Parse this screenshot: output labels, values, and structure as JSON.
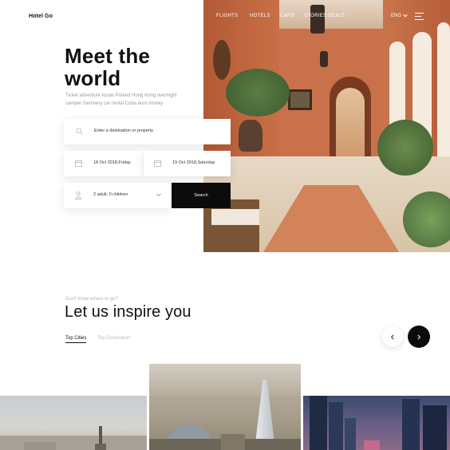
{
  "header": {
    "logo": "Hotel Go",
    "nav": [
      {
        "label": "FLIGHTS"
      },
      {
        "label": "HOTELS"
      },
      {
        "label": "CARS"
      },
      {
        "label": "STORIES"
      },
      {
        "label": "DEALS"
      }
    ],
    "language": "ENG",
    "icons": {
      "menu": "hamburger-menu-icon",
      "language_caret": "chevron-down-icon"
    }
  },
  "hero": {
    "title": "Meet the world",
    "subtitle": "Ticket adventure locals Poland Hong Kong overnight camper Germany car rental Cuba euro money"
  },
  "search": {
    "destination_placeholder": "Enter a destination or property",
    "check_in": "18 Oct 2018,Friday",
    "check_out": "19 Oct 2018,Saturday",
    "guests": "2 adult, 0 children",
    "button_label": "Search",
    "icons": {
      "destination": "search-icon",
      "check_in": "calendar-icon",
      "check_out": "calendar-icon",
      "guests": "user-icon"
    }
  },
  "inspire": {
    "eyebrow": "Don't know where to go?",
    "title": "Let us inspire you",
    "tabs": [
      {
        "label": "Top Cities",
        "active": true
      },
      {
        "label": "Top Destination",
        "active": false
      }
    ],
    "icons": {
      "prev": "chevron-left-icon",
      "next": "chevron-right-icon"
    },
    "cities": [
      {
        "name": "city-card-left"
      },
      {
        "name": "city-card-center"
      },
      {
        "name": "city-card-right"
      }
    ]
  },
  "colors": {
    "accent": "#0b0b0b",
    "muted_text": "#9a9a9a",
    "background": "#ffffff"
  }
}
